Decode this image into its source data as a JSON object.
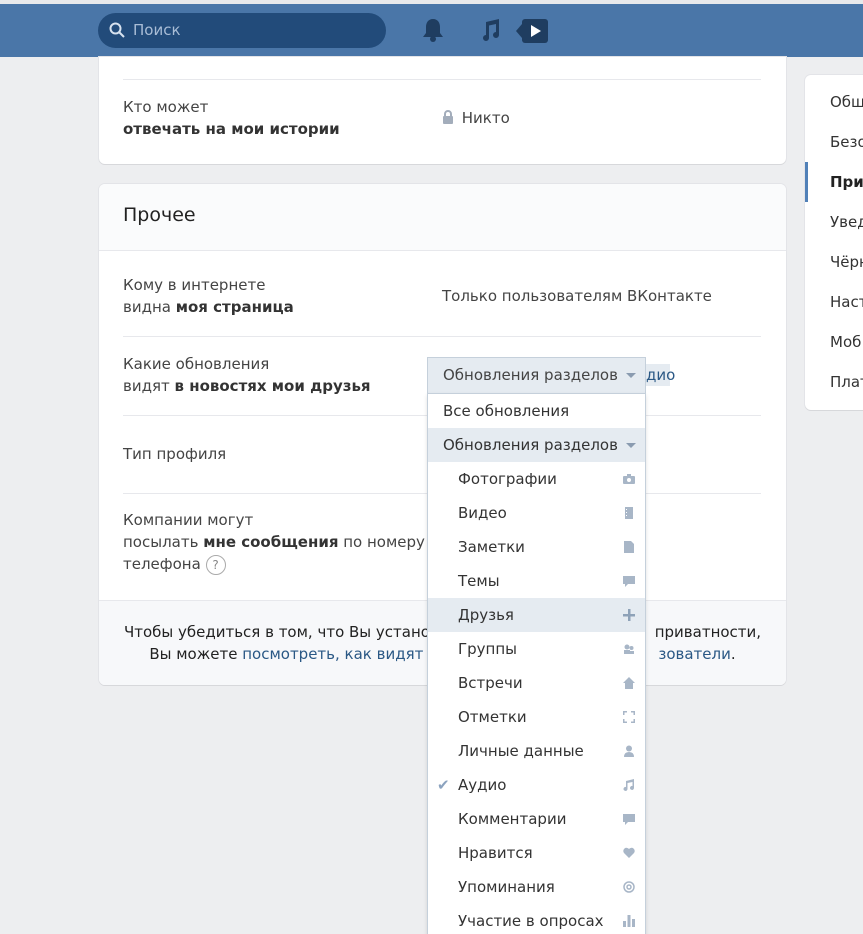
{
  "topbar": {
    "search_placeholder": "Поиск"
  },
  "privacy_top": {
    "row_label_line1": "Кто может",
    "row_label_line2": "отвечать на мои истории",
    "row_value": "Никто"
  },
  "other": {
    "title": "Прочее",
    "rows": [
      {
        "line1_plain": "Кому в интернете",
        "line2_plain": "видна ",
        "line2_bold": "моя страница",
        "value": "Только пользователям ВКонтакте"
      },
      {
        "line1_plain": "Какие обновления",
        "line2_plain": "видят ",
        "line2_bold": "в новостях мои друзья",
        "value_visible_tail": "дио"
      },
      {
        "line1_plain": "Тип профиля"
      },
      {
        "line1_plain": "Компании могут",
        "line2_plain": "посылать ",
        "line2_bold": "мне сообщения",
        "line2_tail": " по номеру",
        "line3_plain": "телефона",
        "help": "?"
      }
    ],
    "footer_line1_left": "Чтобы убедиться в том, что Вы устано",
    "footer_line1_right": " приватности,",
    "footer_line2_left": "Вы можете ",
    "footer_line2_link": "посмотреть, как видят",
    "footer_line2_link_tail": "зователи",
    "footer_line2_end": "."
  },
  "right_menu": {
    "items": [
      "Общ",
      "Безо",
      "При",
      "Увед",
      "Чёрн",
      "Наст",
      "Моб",
      "Плат"
    ],
    "active_index": 2
  },
  "dropdown": {
    "selected": "Обновления разделов",
    "options_top": [
      "Все обновления",
      "Обновления разделов"
    ],
    "sections": [
      {
        "label": "Фотографии",
        "icon": "camera-icon",
        "checked": false
      },
      {
        "label": "Видео",
        "icon": "film-icon",
        "checked": false
      },
      {
        "label": "Заметки",
        "icon": "note-icon",
        "checked": false
      },
      {
        "label": "Темы",
        "icon": "comment-icon",
        "checked": false
      },
      {
        "label": "Друзья",
        "icon": "plus-icon",
        "checked": false
      },
      {
        "label": "Группы",
        "icon": "group-icon",
        "checked": false
      },
      {
        "label": "Встречи",
        "icon": "home-icon",
        "checked": false
      },
      {
        "label": "Отметки",
        "icon": "frame-icon",
        "checked": false
      },
      {
        "label": "Личные данные",
        "icon": "user-icon",
        "checked": false
      },
      {
        "label": "Аудио",
        "icon": "music-icon",
        "checked": true
      },
      {
        "label": "Комментарии",
        "icon": "comment-icon",
        "checked": false
      },
      {
        "label": "Нравится",
        "icon": "heart-icon",
        "checked": false
      },
      {
        "label": "Упоминания",
        "icon": "at-icon",
        "checked": false
      },
      {
        "label": "Участие в опросах",
        "icon": "poll-icon",
        "checked": false
      }
    ],
    "hover_index": 4
  },
  "colors": {
    "header": "#4a76a8",
    "accent": "#5181b8",
    "link": "#2a5885"
  }
}
